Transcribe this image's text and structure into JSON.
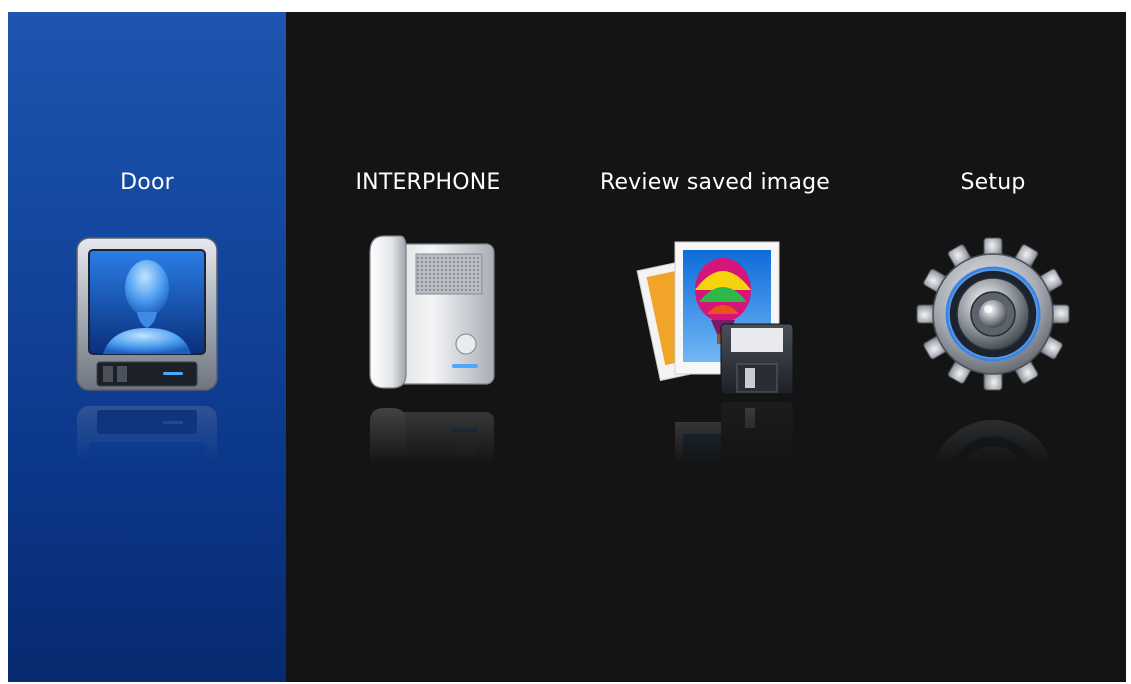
{
  "menu": {
    "selected_index": 0,
    "items": [
      {
        "label": "Door",
        "icon": "door-monitor-icon",
        "selected": true
      },
      {
        "label": "INTERPHONE",
        "icon": "interphone-icon",
        "selected": false
      },
      {
        "label": "Review saved image",
        "icon": "saved-image-icon",
        "selected": false
      },
      {
        "label": "Setup",
        "icon": "gear-icon",
        "selected": false
      }
    ]
  },
  "colors": {
    "background": "#141414",
    "selected_highlight": "#14469e",
    "label_text": "#ffffff",
    "accent_glow": "#4aa8ff"
  }
}
